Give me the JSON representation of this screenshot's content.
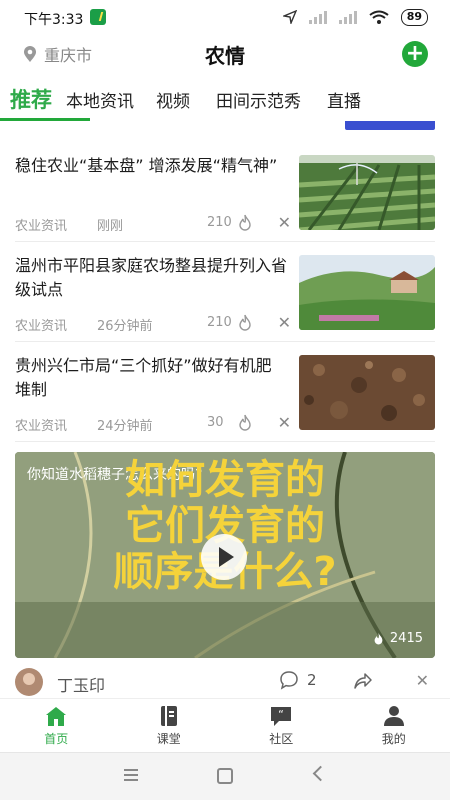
{
  "status_bar": {
    "time": "下午3:33",
    "battery": "89"
  },
  "header": {
    "location": "重庆市",
    "title": "农情",
    "add_label": "+"
  },
  "tabs": [
    {
      "label": "推荐",
      "active": true
    },
    {
      "label": "本地资讯"
    },
    {
      "label": "视频"
    },
    {
      "label": "田间示范秀"
    },
    {
      "label": "直播"
    }
  ],
  "news": [
    {
      "title": "稳住农业“基本盘” 增添发展“精气神”",
      "source": "农业资讯",
      "time": "刚刚",
      "count": "210"
    },
    {
      "title": "温州市平阳县家庭农场整县提升列入省级试点",
      "source": "农业资讯",
      "time": "26分钟前",
      "count": "210"
    },
    {
      "title": "贵州兴仁市局“三个抓好”做好有机肥堆制",
      "source": "农业资讯",
      "time": "24分钟前",
      "count": "30"
    }
  ],
  "video": {
    "caption": "你知道水稻穗子怎么来的吗?",
    "overlay_lines": [
      "如何发育的",
      "它们发育的",
      "顺序是什么?"
    ],
    "views": "2415"
  },
  "author": {
    "name": "丁玉印",
    "comments": "2"
  },
  "bottom_nav": [
    {
      "label": "首页",
      "icon": "home-icon",
      "active": true
    },
    {
      "label": "课堂",
      "icon": "book-icon"
    },
    {
      "label": "社区",
      "icon": "chat-quote-icon"
    },
    {
      "label": "我的",
      "icon": "person-icon"
    }
  ],
  "colors": {
    "accent": "#2faa4a",
    "fab": "#22a83a",
    "overlay_text": "#f5d33a"
  }
}
